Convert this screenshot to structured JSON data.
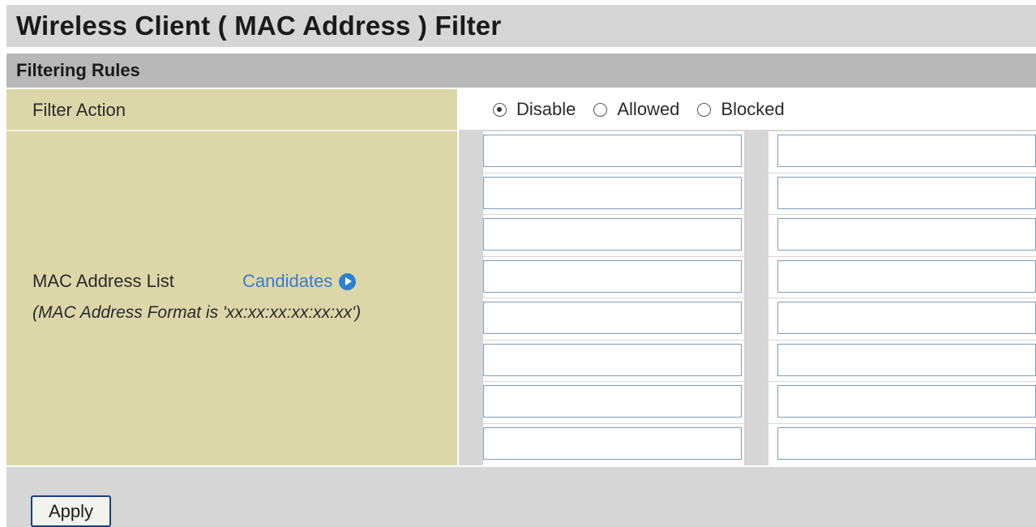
{
  "page": {
    "title": "Wireless Client ( MAC Address ) Filter",
    "section_title": "Filtering Rules"
  },
  "filter_action": {
    "label": "Filter Action",
    "options": [
      {
        "label": "Disable",
        "checked": true
      },
      {
        "label": "Allowed",
        "checked": false
      },
      {
        "label": "Blocked",
        "checked": false
      }
    ]
  },
  "mac_list": {
    "label": "MAC Address List",
    "candidates_label": "Candidates",
    "format_note": "(MAC Address Format is 'xx:xx:xx:xx:xx:xx')",
    "entries": [
      [
        "",
        ""
      ],
      [
        "",
        ""
      ],
      [
        "",
        ""
      ],
      [
        "",
        ""
      ],
      [
        "",
        ""
      ],
      [
        "",
        ""
      ],
      [
        "",
        ""
      ],
      [
        "",
        ""
      ]
    ]
  },
  "actions": {
    "apply_label": "Apply"
  },
  "colors": {
    "title_bg": "#d6d6d6",
    "section_bg": "#b8b8b8",
    "label_cell_bg": "#dcd7a9",
    "link": "#3a7bc8"
  },
  "icons": {
    "candidates": "arrow-right-circle-icon",
    "radio_selected": "radio-selected-icon",
    "radio_unselected": "radio-unselected-icon"
  }
}
